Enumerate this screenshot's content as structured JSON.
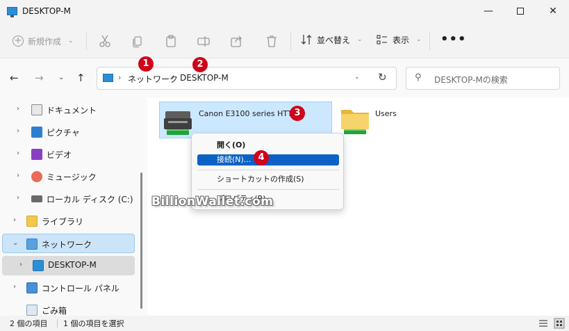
{
  "window": {
    "title": "DESKTOP-M",
    "minimize": "—",
    "close": "✕"
  },
  "toolbar": {
    "new_label": "新規作成",
    "sort_label": "並べ替え",
    "view_label": "表示",
    "more_label": "•••"
  },
  "address": {
    "crumbs": [
      "ネットワーク",
      "DESKTOP-M"
    ],
    "separator": "›"
  },
  "search": {
    "placeholder": "DESKTOP-Mの検索"
  },
  "sidebar": {
    "items": [
      {
        "label": "ドキュメント"
      },
      {
        "label": "ピクチャ"
      },
      {
        "label": "ビデオ"
      },
      {
        "label": "ミュージック"
      },
      {
        "label": "ローカル ディスク (C:)"
      },
      {
        "label": "ライブラリ"
      },
      {
        "label": "ネットワーク"
      },
      {
        "label": "DESKTOP-M"
      },
      {
        "label": "コントロール パネル"
      },
      {
        "label": "ごみ箱"
      }
    ]
  },
  "content": {
    "items": [
      {
        "label": "Canon E3100 series HTTP"
      },
      {
        "label": "Users"
      }
    ]
  },
  "context_menu": {
    "items": [
      {
        "label": "開く(O)"
      },
      {
        "label": "接続(N)..."
      },
      {
        "label": "ショートカットの作成(S)"
      },
      {
        "label": "プロパティ(R)"
      }
    ]
  },
  "badges": [
    "1",
    "2",
    "3",
    "4"
  ],
  "watermark": "BillionWallet.com",
  "status": {
    "item_count": "2 個の項目",
    "selected_count": "1 個の項目を選択"
  },
  "colors": {
    "accent": "#0b62c4",
    "selection": "#cce8ff",
    "badge": "#d0021b"
  }
}
